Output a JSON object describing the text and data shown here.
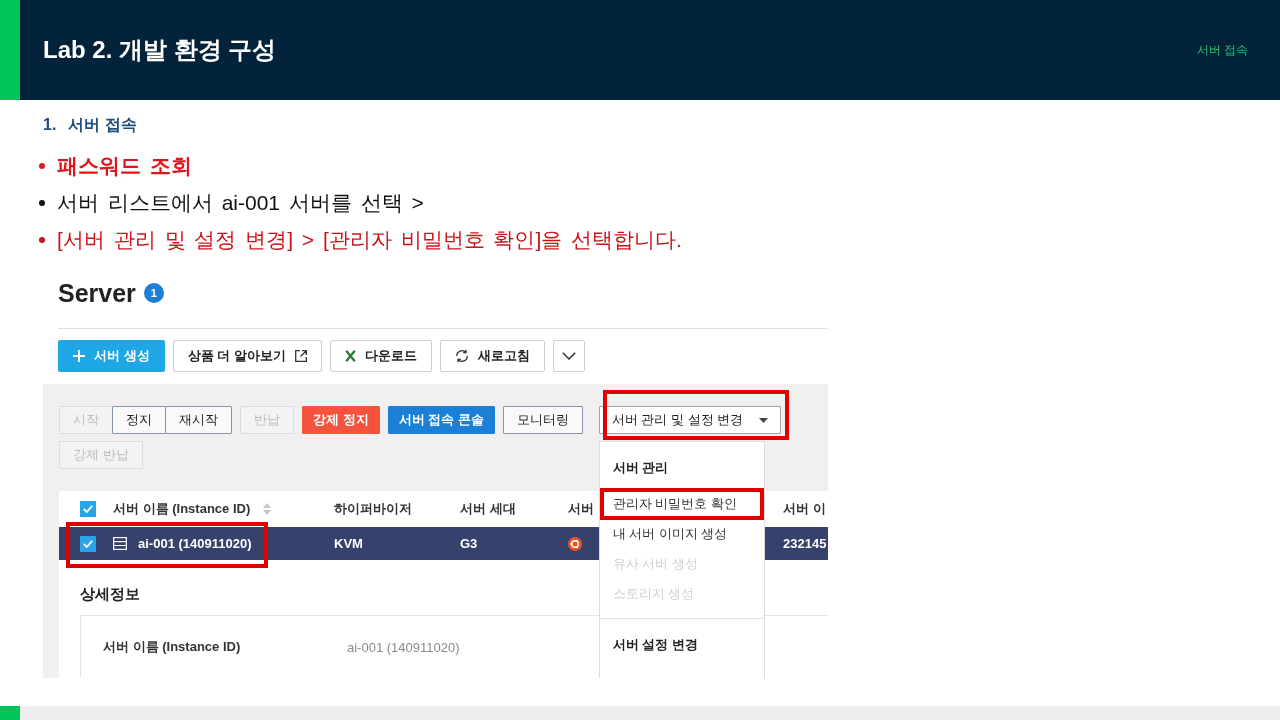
{
  "header": {
    "title": "Lab 2. 개발 환경 구성",
    "section_tag": "서버 접속"
  },
  "section": {
    "number": "1.",
    "title": "서버 접속"
  },
  "bullets": [
    {
      "kind": "emphasis",
      "text": "패스워드 조회"
    },
    {
      "kind": "plain",
      "text": "서버 리스트에서 ai-001 서버를 선택 >"
    },
    {
      "kind": "step",
      "text": "[서버 관리 및 설정 변경] > [관리자 비밀번호 확인]을 선택합니다."
    }
  ],
  "console": {
    "title": "Server",
    "badge": "1",
    "toolbar": [
      {
        "kind": "create",
        "label": "서버 생성"
      },
      {
        "kind": "external",
        "label": "상품 더 알아보기"
      },
      {
        "kind": "download",
        "label": "다운로드"
      },
      {
        "kind": "refresh",
        "label": "새로고침"
      },
      {
        "kind": "more"
      }
    ],
    "action_rows": [
      {
        "groups": [
          {
            "buttons": [
              {
                "label": "시작",
                "kind": "default",
                "disabled": true
              },
              {
                "label": "정지",
                "kind": "default",
                "disabled": false
              },
              {
                "label": "재시작",
                "kind": "default",
                "disabled": false
              }
            ]
          },
          {
            "buttons": [
              {
                "label": "반납",
                "kind": "default",
                "disabled": true
              }
            ]
          },
          {
            "buttons": [
              {
                "label": "강제 정지",
                "kind": "danger",
                "disabled": false
              }
            ]
          },
          {
            "buttons": [
              {
                "label": "서버 접속 콘솔",
                "kind": "primary",
                "disabled": false
              }
            ]
          },
          {
            "buttons": [
              {
                "label": "모니터링",
                "kind": "default",
                "disabled": false
              }
            ]
          }
        ],
        "menu_button": {
          "label": "서버 관리 및 설정 변경",
          "expanded": true,
          "highlighted": true,
          "menu": [
            {
              "title": "서버 관리",
              "items": [
                {
                  "label": "관리자 비밀번호 확인",
                  "disabled": false,
                  "highlighted": true
                },
                {
                  "label": "내 서버 이미지 생성",
                  "disabled": false,
                  "highlighted": false
                },
                {
                  "label": "유사 서버 생성",
                  "disabled": true,
                  "highlighted": false
                },
                {
                  "label": "스토리지 생성",
                  "disabled": true,
                  "highlighted": false
                }
              ]
            },
            {
              "title": "서버 설정 변경"
            }
          ]
        }
      },
      {
        "groups": [
          {
            "buttons": [
              {
                "label": "강제 반납",
                "kind": "default",
                "disabled": true
              }
            ]
          }
        ]
      }
    ],
    "table": {
      "header_checked": true,
      "columns": [
        {
          "label": "서버 이름 (Instance ID)",
          "sortable": true
        },
        {
          "label": "하이퍼바이저",
          "sortable": false
        },
        {
          "label": "서버 세대",
          "sortable": false
        },
        {
          "label": "서버",
          "sortable": false
        },
        {
          "label": "서버 이",
          "sortable": false
        }
      ],
      "rows": [
        {
          "selected": true,
          "checked": true,
          "highlighted": true,
          "cells": [
            {
              "kind": "server",
              "text": "ai-001 (140911020)"
            },
            {
              "kind": "text",
              "text": "KVM"
            },
            {
              "kind": "text",
              "text": "G3"
            },
            {
              "kind": "os"
            },
            {
              "kind": "text",
              "text": "232145"
            }
          ]
        }
      ]
    },
    "detail": {
      "title": "상세정보",
      "fields": [
        {
          "label": "서버 이름 (Instance ID)",
          "value": "ai-001 (140911020)"
        }
      ]
    }
  }
}
